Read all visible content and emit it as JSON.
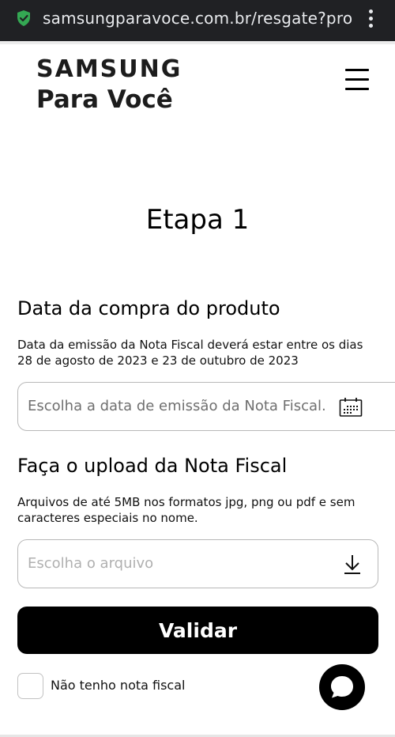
{
  "browser": {
    "url": "samsungparavoce.com.br/resgate?pro",
    "icons": {
      "security": "shield-check-icon",
      "menu": "kebab-menu-icon"
    }
  },
  "header": {
    "logo_line1": "SAMSUNG",
    "logo_line2": "Para Você",
    "menu_icon": "hamburger-menu-icon"
  },
  "page": {
    "step_title": "Etapa 1"
  },
  "purchase_date": {
    "title": "Data da compra do produto",
    "description": "Data da emissão da Nota Fiscal deverá estar entre os dias 28 de agosto de 2023 e 23 de outubro de 2023",
    "placeholder": "Escolha a data de emissão da Nota Fiscal.",
    "icon": "calendar-icon"
  },
  "upload": {
    "title": "Faça o upload da Nota Fiscal",
    "description": "Arquivos de até 5MB nos formatos jpg, png ou pdf e sem caracteres especiais no nome.",
    "placeholder": "Escolha o arquivo",
    "icon": "download-icon"
  },
  "actions": {
    "validate_label": "Validar",
    "no_invoice_label": "Não tenho nota fiscal",
    "no_invoice_checked": false,
    "chat_icon": "chat-bubble-icon"
  },
  "colors": {
    "browser_bar": "#202124",
    "shield_green": "#34a853",
    "button_bg": "#000000",
    "button_text": "#ffffff"
  }
}
